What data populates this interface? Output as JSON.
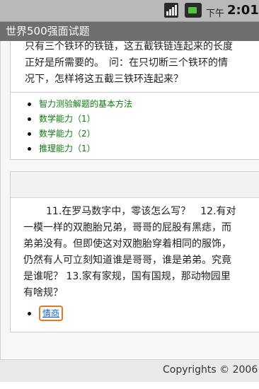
{
  "status_bar": {
    "ampm": "下午",
    "time": "2:01"
  },
  "app": {
    "title": "世界500强面试题"
  },
  "card1": {
    "lines": [
      "只有三个铁环的铁链，这五截铁链连起来的长度",
      "正好是所需要的。　问：在只切断三个铁环的情",
      "况下，怎样将这五截三铁环连起来？"
    ],
    "links": [
      "智力测验解题的基本方法",
      "数学能力（1）",
      "数学能力（2）",
      "推理能力（1）"
    ]
  },
  "card2": {
    "lines": [
      "11.在罗马数字中，零该怎么写？　12.有对",
      "一模一样的双胞胎兄弟，哥哥的屁股有黑痣，而",
      "弟弟没有。但即使这对双胞胎穿着相同的服饰，",
      "仍然有人可立刻知道谁是哥哥，谁是弟弟。究竟",
      "是谁呢？ 13.家有家规，国有国规，那动物园里",
      "有啥规？"
    ],
    "tag": "情商"
  },
  "footer": {
    "copyright": "Copyrights © 2006"
  },
  "colors": {
    "title_bar": "#6f6f6f",
    "link_green": "#0f7d0f",
    "tag_border": "#e07a22",
    "tag_text": "#1a5fb4"
  }
}
